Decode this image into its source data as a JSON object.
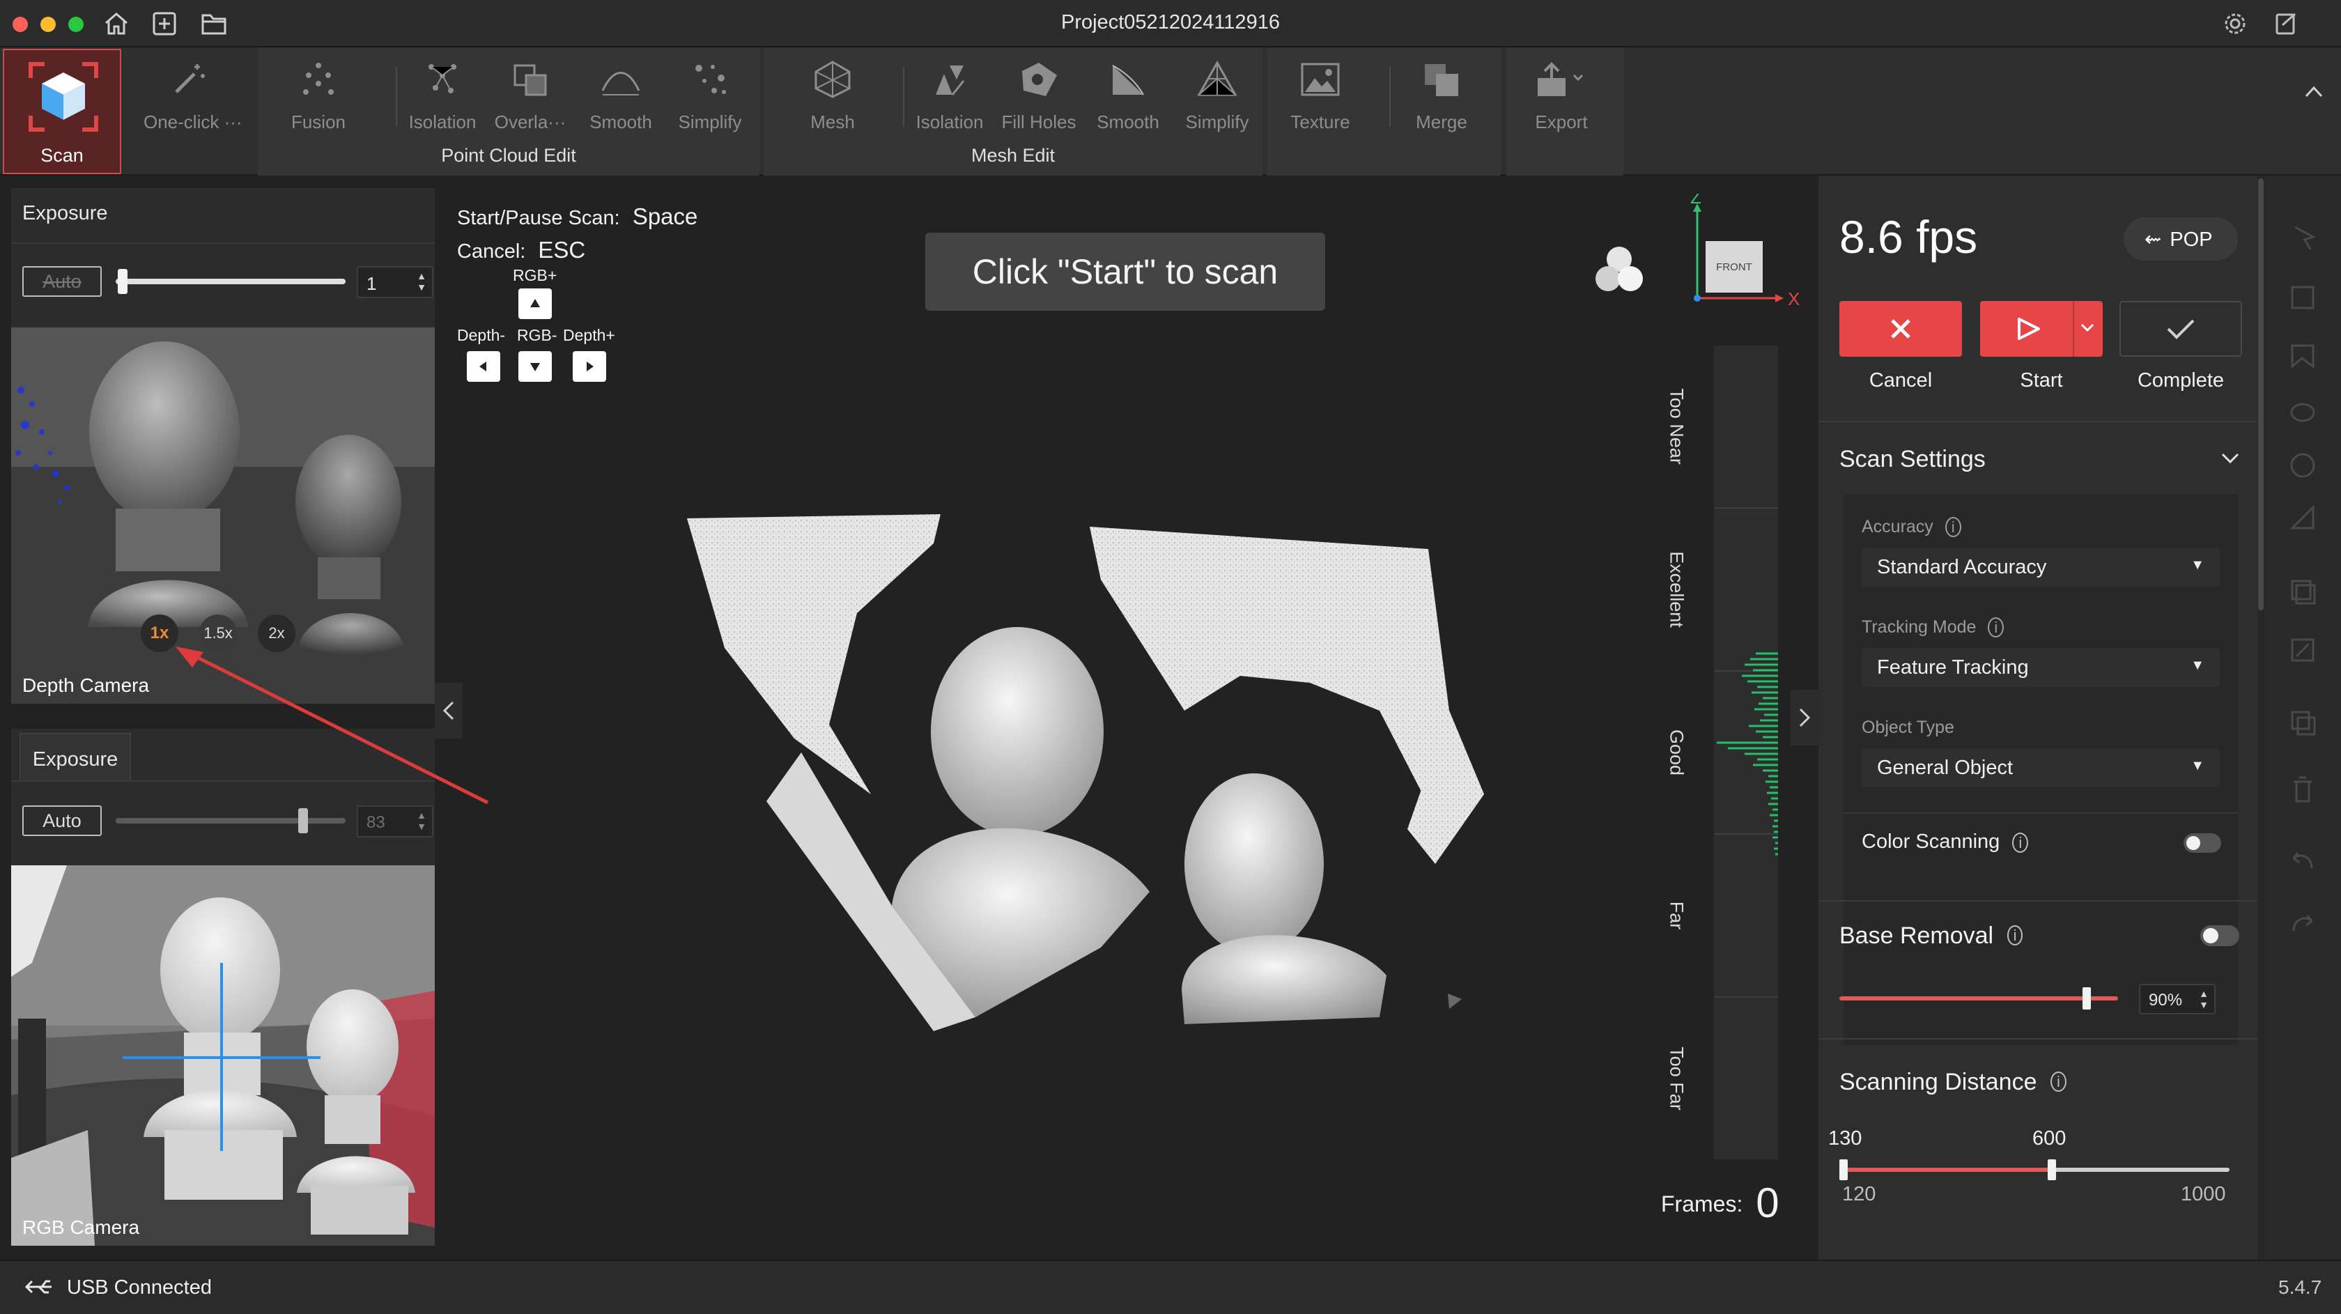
{
  "window": {
    "title": "Project05212024112916",
    "version": "5.4.7"
  },
  "ribbon": {
    "scan": {
      "label": "Scan"
    },
    "one_click": {
      "label": "One-click ···"
    },
    "point_cloud_edit": {
      "group_label": "Point Cloud Edit",
      "tools": [
        "Fusion",
        "Isolation",
        "Overla···",
        "Smooth",
        "Simplify"
      ]
    },
    "mesh_edit": {
      "group_label": "Mesh Edit",
      "tools": [
        "Mesh",
        "Isolation",
        "Fill Holes",
        "Smooth",
        "Simplify"
      ]
    },
    "texture": {
      "label": "Texture"
    },
    "merge": {
      "label": "Merge"
    },
    "export": {
      "label": "Export"
    }
  },
  "depth_panel": {
    "title": "Exposure",
    "auto_label": "Auto",
    "exposure_value": "1",
    "exposure_level": 0.01,
    "camera_label": "Depth Camera",
    "zoom_options": [
      "1x",
      "1.5x",
      "2x"
    ],
    "zoom_selected": "1x"
  },
  "rgb_panel": {
    "title": "Exposure",
    "auto_label": "Auto",
    "exposure_value": "83",
    "exposure_level": 0.83,
    "camera_label": "RGB Camera"
  },
  "viewport": {
    "hint_start_label": "Start/Pause Scan:",
    "hint_start_key": "Space",
    "hint_cancel_label": "Cancel:",
    "hint_cancel_key": "ESC",
    "rgb_plus": "RGB+",
    "depth_minus": "Depth-",
    "rgb_minus": "RGB-",
    "depth_plus": "Depth+",
    "banner": "Click \"Start\" to scan",
    "axis_z": "Z",
    "axis_x": "X",
    "cube_face": "FRONT",
    "distance_labels": [
      "Too Near",
      "Excellent",
      "Good",
      "Far",
      "Too Far"
    ],
    "frames_label": "Frames:",
    "frames_value": "0"
  },
  "right_panel": {
    "fps": "8.6 fps",
    "pop_label": "POP",
    "cancel_label": "Cancel",
    "start_label": "Start",
    "complete_label": "Complete",
    "scan_settings": {
      "title": "Scan Settings",
      "accuracy_label": "Accuracy",
      "accuracy_value": "Standard Accuracy",
      "tracking_label": "Tracking Mode",
      "tracking_value": "Feature Tracking",
      "object_type_label": "Object Type",
      "object_type_value": "General Object",
      "color_scanning_label": "Color Scanning",
      "color_scanning_on": false
    },
    "base_removal": {
      "title": "Base Removal",
      "enabled": false,
      "value": "90%",
      "level": 0.9
    },
    "scanning_distance": {
      "title": "Scanning Distance",
      "low": "130",
      "high": "600",
      "min": "120",
      "max": "1000"
    }
  },
  "status": {
    "connection": "USB Connected"
  },
  "colors": {
    "accent_red": "#e64646",
    "green_bars": "#26c06a",
    "background": "#222222"
  }
}
